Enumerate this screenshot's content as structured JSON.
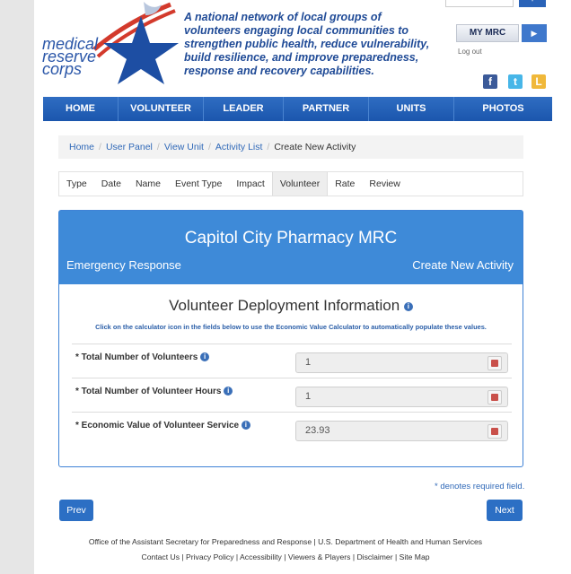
{
  "header": {
    "logo_lines": [
      "medical",
      "reserve",
      "corps"
    ],
    "tagline": "A national network of local groups of volunteers engaging local communities to strengthen public health, reduce vulnerability, build resilience, and improve preparedness, response and recovery capabilities.",
    "search_placeholder": "Search",
    "my_mrc_label": "MY MRC",
    "logout_label": "Log out",
    "social": [
      "f",
      "t",
      "L"
    ]
  },
  "nav": {
    "items": [
      "HOME",
      "VOLUNTEER",
      "LEADER",
      "PARTNER",
      "UNITS",
      "PHOTOS"
    ]
  },
  "breadcrumb": {
    "items": [
      "Home",
      "User Panel",
      "View Unit",
      "Activity List"
    ],
    "current": "Create New Activity"
  },
  "tabs": [
    "Type",
    "Date",
    "Name",
    "Event Type",
    "Impact",
    "Volunteer",
    "Rate",
    "Review"
  ],
  "active_tab": "Volunteer",
  "panel": {
    "title": "Capitol City Pharmacy MRC",
    "left": "Emergency Response",
    "right": "Create New Activity",
    "section_title": "Volunteer Deployment Information",
    "section_sub": "Click on the calculator icon in the fields below to use the Economic Value Calculator to automatically populate these values.",
    "fields": [
      {
        "label": "* Total Number of Volunteers",
        "value": "1"
      },
      {
        "label": "* Total Number of Volunteer Hours",
        "value": "1"
      },
      {
        "label": "* Economic Value of Volunteer Service",
        "value": "23.93"
      }
    ]
  },
  "required_note": "* denotes required field.",
  "prev_label": "Prev",
  "next_label": "Next",
  "footer": {
    "line1": "Office of the Assistant Secretary for Preparedness and Response | U.S. Department of Health and Human Services",
    "links": [
      "Contact Us",
      "Privacy Policy",
      "Accessibility",
      "Viewers & Players",
      "Disclaimer",
      "Site Map"
    ]
  },
  "colors": {
    "primary": "#2c6fc4",
    "panel_header": "#3e8ad8",
    "calculator_icon": "#c9504a"
  }
}
